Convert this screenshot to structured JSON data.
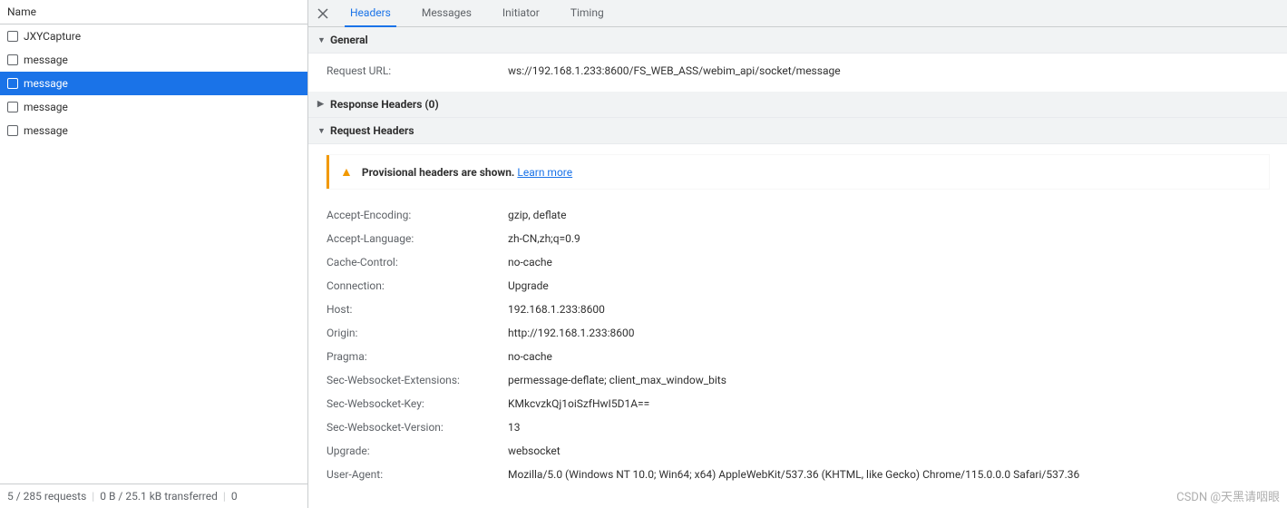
{
  "left": {
    "header": "Name",
    "requests": [
      {
        "label": "JXYCapture",
        "selected": false
      },
      {
        "label": "message",
        "selected": false
      },
      {
        "label": "message",
        "selected": true
      },
      {
        "label": "message",
        "selected": false
      },
      {
        "label": "message",
        "selected": false
      }
    ],
    "footer": {
      "requests": "5 / 285 requests",
      "transferred": "0 B / 25.1 kB transferred",
      "extra": "0"
    }
  },
  "tabs": {
    "items": [
      {
        "label": "Headers",
        "active": true
      },
      {
        "label": "Messages",
        "active": false
      },
      {
        "label": "Initiator",
        "active": false
      },
      {
        "label": "Timing",
        "active": false
      }
    ]
  },
  "sections": {
    "general": {
      "title": "General",
      "expanded": true,
      "rows": [
        {
          "name": "Request URL:",
          "value": "ws://192.168.1.233:8600/FS_WEB_ASS/webim_api/socket/message"
        }
      ]
    },
    "responseHeaders": {
      "title": "Response Headers (0)",
      "expanded": false
    },
    "requestHeaders": {
      "title": "Request Headers",
      "expanded": true,
      "warning": {
        "text": "Provisional headers are shown.",
        "link": "Learn more"
      },
      "rows": [
        {
          "name": "Accept-Encoding:",
          "value": "gzip, deflate"
        },
        {
          "name": "Accept-Language:",
          "value": "zh-CN,zh;q=0.9"
        },
        {
          "name": "Cache-Control:",
          "value": "no-cache"
        },
        {
          "name": "Connection:",
          "value": "Upgrade"
        },
        {
          "name": "Host:",
          "value": "192.168.1.233:8600"
        },
        {
          "name": "Origin:",
          "value": "http://192.168.1.233:8600"
        },
        {
          "name": "Pragma:",
          "value": "no-cache"
        },
        {
          "name": "Sec-Websocket-Extensions:",
          "value": "permessage-deflate; client_max_window_bits"
        },
        {
          "name": "Sec-Websocket-Key:",
          "value": "KMkcvzkQj1oiSzfHwI5D1A=="
        },
        {
          "name": "Sec-Websocket-Version:",
          "value": "13"
        },
        {
          "name": "Upgrade:",
          "value": "websocket"
        },
        {
          "name": "User-Agent:",
          "value": "Mozilla/5.0 (Windows NT 10.0; Win64; x64) AppleWebKit/537.36 (KHTML, like Gecko) Chrome/115.0.0.0 Safari/537.36"
        }
      ]
    }
  },
  "watermark": "CSDN @天黑请咽眼"
}
